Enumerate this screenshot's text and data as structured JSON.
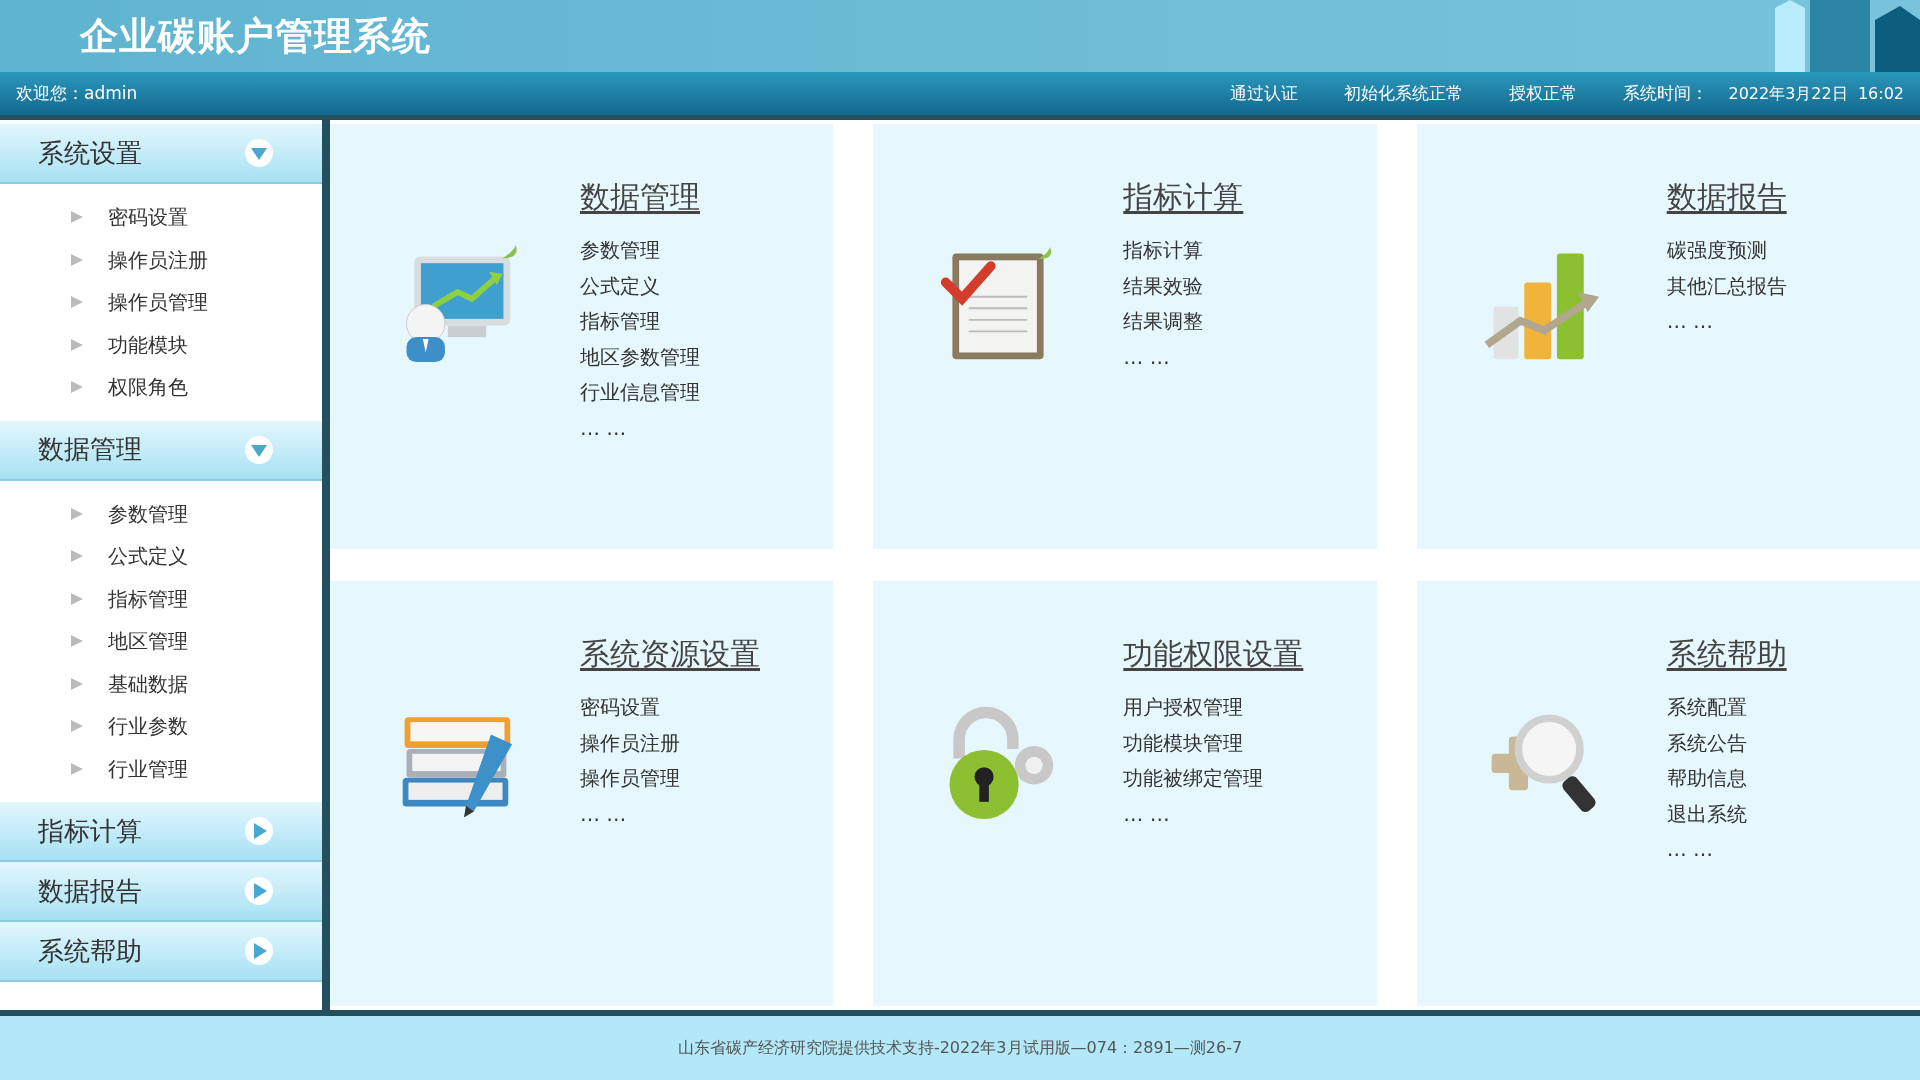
{
  "header": {
    "title": "企业碳账户管理系统"
  },
  "nav": {
    "welcome": "欢迎您：admin",
    "statuses": [
      "通过认证",
      "初始化系统正常",
      "授权正常"
    ],
    "time_label": "系统时间：",
    "time_value": "2022年3月22日  16:02"
  },
  "sidebar": {
    "groups": [
      {
        "label": "系统设置",
        "expanded": true,
        "items": [
          "密码设置",
          "操作员注册",
          "操作员管理",
          "功能模块",
          "权限角色"
        ]
      },
      {
        "label": "数据管理",
        "expanded": true,
        "items": [
          "参数管理",
          "公式定义",
          "指标管理",
          "地区管理",
          "基础数据",
          "行业参数",
          "行业管理"
        ]
      },
      {
        "label": "指标计算",
        "expanded": false
      },
      {
        "label": "数据报告",
        "expanded": false
      },
      {
        "label": "系统帮助",
        "expanded": false
      }
    ]
  },
  "cards": [
    {
      "title": "数据管理",
      "links": [
        "参数管理",
        "公式定义",
        "指标管理",
        "地区参数管理",
        "行业信息管理",
        "… …"
      ]
    },
    {
      "title": "指标计算",
      "links": [
        "指标计算",
        "结果效验",
        "结果调整",
        "… …"
      ]
    },
    {
      "title": "数据报告",
      "links": [
        "碳强度预测",
        "其他汇总报告",
        "… …"
      ]
    },
    {
      "title": "系统资源设置",
      "links": [
        "密码设置",
        "操作员注册",
        "操作员管理",
        "… …"
      ]
    },
    {
      "title": "功能权限设置",
      "links": [
        "用户授权管理",
        "功能模块管理",
        "功能被绑定管理",
        "… …"
      ]
    },
    {
      "title": "系统帮助",
      "links": [
        "系统配置",
        "系统公告",
        "帮助信息",
        "退出系统",
        "… …"
      ]
    }
  ],
  "footer": {
    "text": "山东省碳产经济研究院提供技术支持-2022年3月试用版—074：2891—测26-7"
  }
}
